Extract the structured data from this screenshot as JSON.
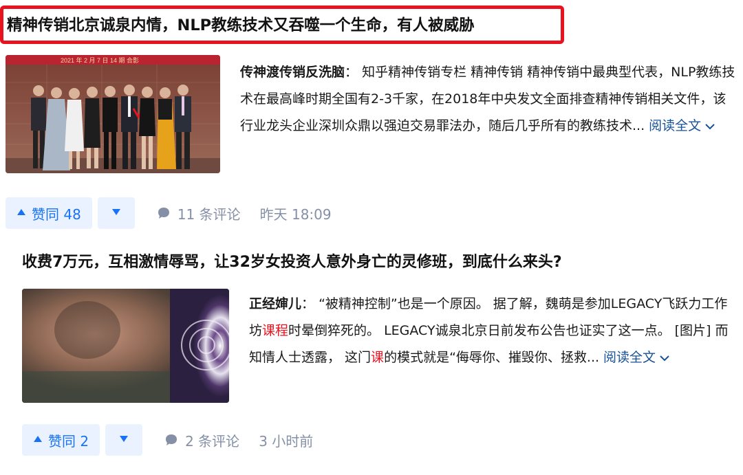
{
  "articles": [
    {
      "title": "精神传销北京诚泉内情，NLP教练技术又吞噬一个生命，有人被威胁",
      "thumbnail_caption": "2021 年 2 月 7 日 14 期 合影",
      "author": "传神渡传销反洗脑",
      "colon": "：",
      "excerpt": "知乎精神传销专栏 精神传销 精神传销中最典型代表，NLP教练技术在最高峰时期全国有2-3千家，在2018年中央发文全面排查精神传销相关文件，该行业龙头企业深圳众鼎以强迫交易罪法办，随后几乎所有的教练技术...",
      "read_more": "阅读全文",
      "vote_label": "赞同 48",
      "comments": "11 条评论",
      "time": "昨天 18:09"
    },
    {
      "title": "收费7万元，互相激情辱骂，让32岁女投资人意外身亡的灵修班，到底什么来头?",
      "author": "正经婶儿",
      "colon": "：",
      "excerpt_a": "“被精神控制”也是一个原因。 据了解，魏萌是参加LEGACY飞跃力工作坊",
      "excerpt_hl1": "课程",
      "excerpt_b": "时晕倒猝死的。 LEGACY诚泉北京日前发布公告也证实了这一点。 [图片] 而知情人士透露， 这门",
      "excerpt_hl2": "课",
      "excerpt_c": "的模式就是“侮辱你、摧毁你、拯救...",
      "read_more": "阅读全文",
      "vote_label": "赞同 2",
      "comments": "2 条评论",
      "time": "3 小时前"
    }
  ],
  "colors": {
    "highlight_border": "#e8131f",
    "link": "#175199",
    "vote": "#1772f6",
    "vote_bg": "#eaf2ff",
    "meta": "#8590a6"
  },
  "icons": {
    "up": "triangle-up-icon",
    "down": "triangle-down-icon",
    "comment": "comment-bubble-icon",
    "chevron": "chevron-down-icon"
  }
}
